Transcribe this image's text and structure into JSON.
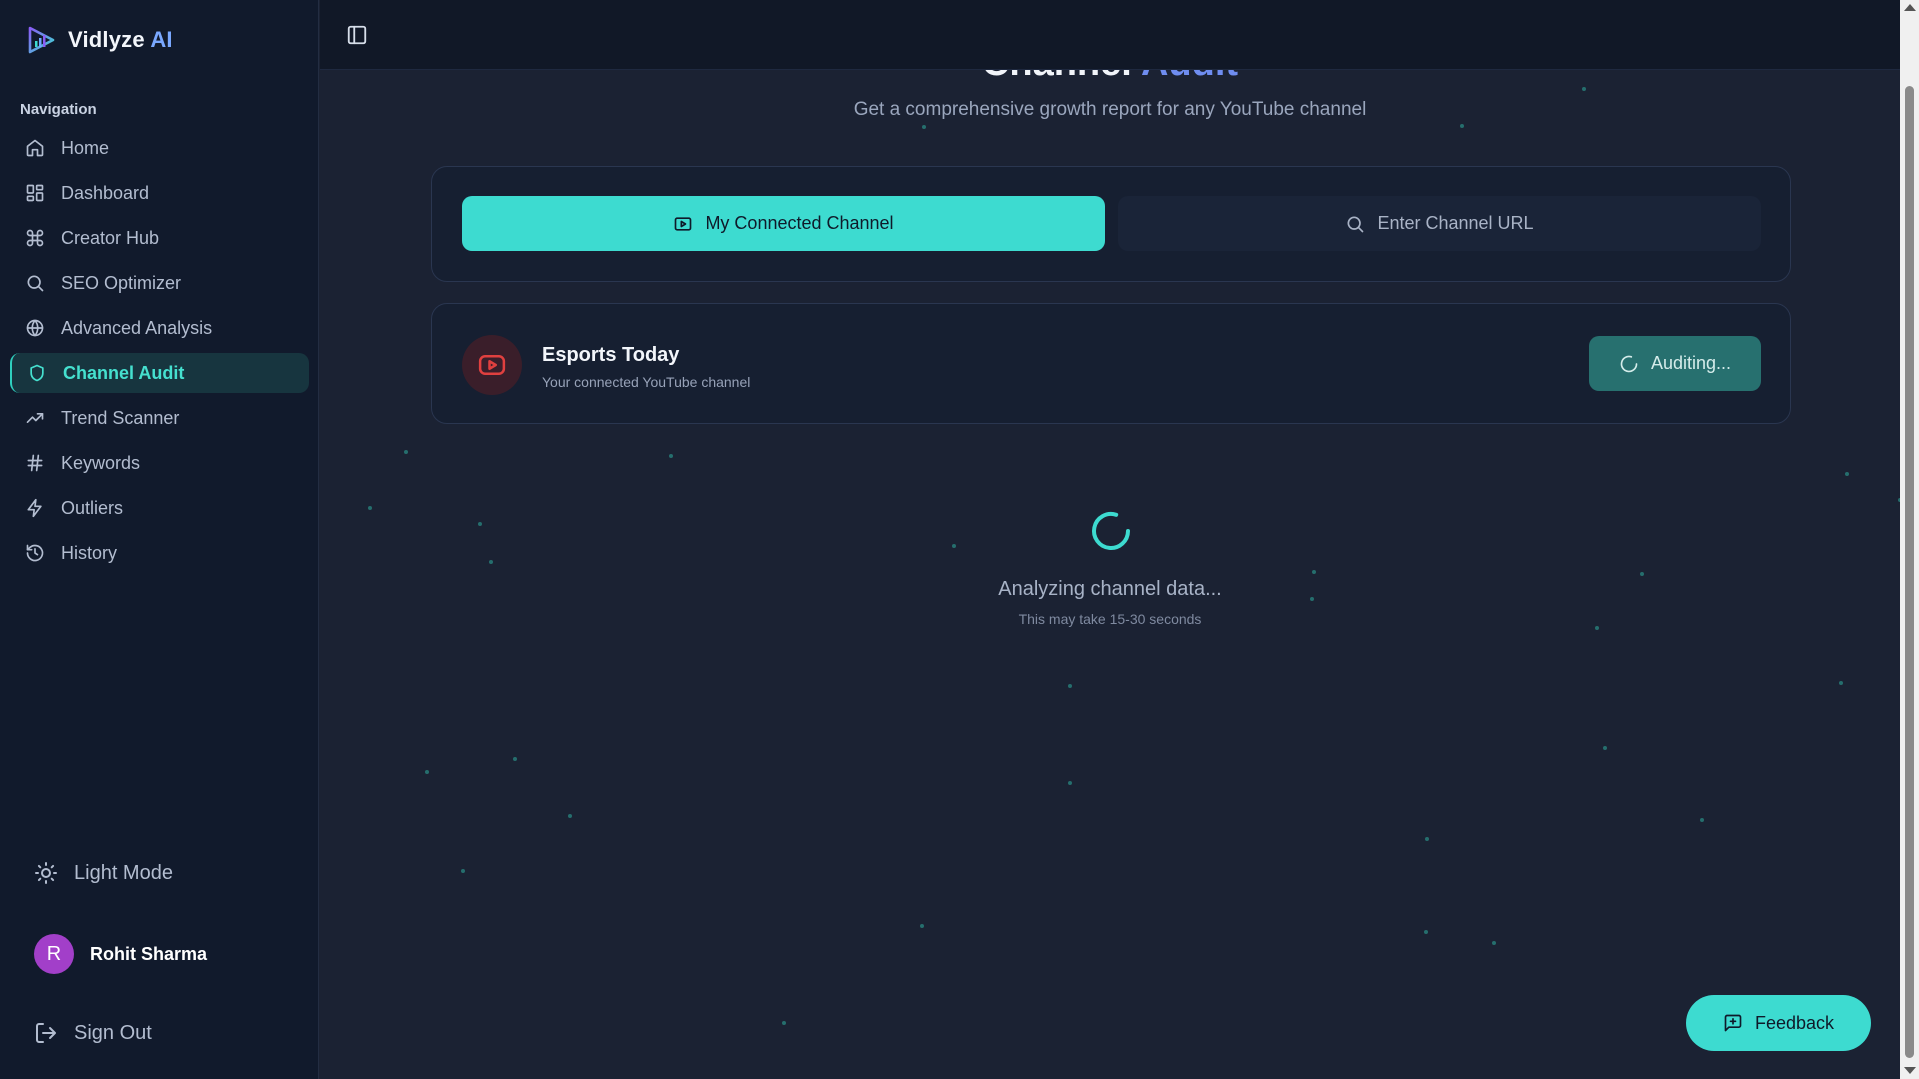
{
  "brand": {
    "name": "Vidlyze",
    "suffix": "AI"
  },
  "nav": {
    "heading": "Navigation",
    "items": [
      {
        "label": "Home",
        "icon": "home-icon"
      },
      {
        "label": "Dashboard",
        "icon": "dashboard-icon"
      },
      {
        "label": "Creator Hub",
        "icon": "command-icon"
      },
      {
        "label": "SEO Optimizer",
        "icon": "search-icon"
      },
      {
        "label": "Advanced Analysis",
        "icon": "globe-icon"
      },
      {
        "label": "Channel Audit",
        "icon": "shield-icon",
        "active": true
      },
      {
        "label": "Trend Scanner",
        "icon": "trending-up-icon"
      },
      {
        "label": "Keywords",
        "icon": "hash-icon"
      },
      {
        "label": "Outliers",
        "icon": "zap-icon"
      },
      {
        "label": "History",
        "icon": "history-icon"
      }
    ]
  },
  "sidebar_footer": {
    "theme_toggle": "Light Mode",
    "user_initial": "R",
    "user_name": "Rohit Sharma",
    "sign_out": "Sign Out"
  },
  "page": {
    "title_main": "Channel",
    "title_accent": "Audit",
    "subtitle": "Get a comprehensive growth report for any YouTube channel"
  },
  "tabs": {
    "connected": "My Connected Channel",
    "url": "Enter Channel URL"
  },
  "channel": {
    "name": "Esports Today",
    "subtitle": "Your connected YouTube channel",
    "button": "Auditing..."
  },
  "loading": {
    "text": "Analyzing channel data...",
    "subtext": "This may take 15-30 seconds"
  },
  "feedback": {
    "label": "Feedback"
  },
  "colors": {
    "accent": "#3ddbd0",
    "background": "#1b2233",
    "sidebar": "#111a2c",
    "youtube_red": "#e0403f",
    "avatar": "#a23fc9"
  }
}
